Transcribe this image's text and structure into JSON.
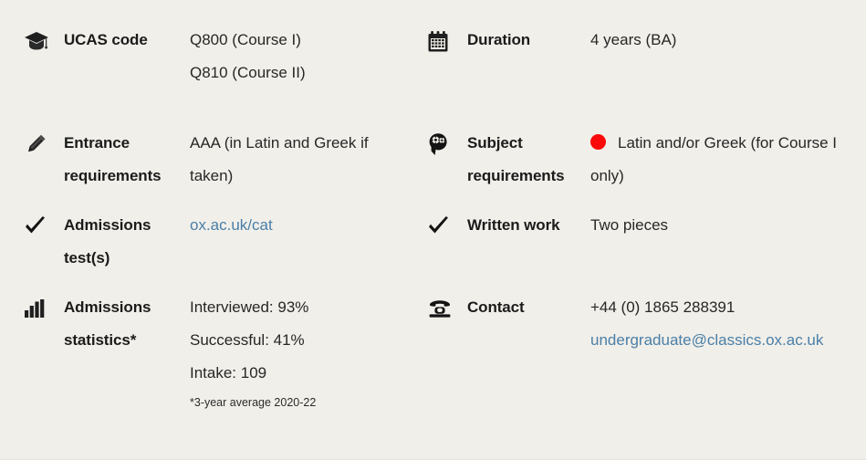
{
  "page": {
    "background_color": "#f1efe9",
    "text_color": "#1b1b1b",
    "link_color": "#4a7fa8",
    "bullet_color": "#fa0a0a"
  },
  "columns": {
    "left": [
      {
        "icon": "graduation-cap-icon",
        "label": "UCAS code",
        "values": [
          "Q800 (Course I)",
          "Q810 (Course II)"
        ]
      },
      {
        "icon": "pencil-icon",
        "label": "Entrance requirements",
        "values": [
          "AAA (in Latin and Greek if taken)"
        ]
      },
      {
        "icon": "checkmark-icon",
        "label": "Admissions test(s)",
        "values": [
          "ox.ac.uk/cat"
        ],
        "link": "ox.ac.uk/cat"
      },
      {
        "icon": "bar-chart-icon",
        "label": "Admissions statistics*",
        "values": [
          "Interviewed: 93%",
          "Successful: 41%",
          "Intake: 109"
        ],
        "footnote": "*3-year average 2020-22"
      }
    ],
    "right": [
      {
        "icon": "calendar-icon",
        "label": "Duration",
        "values": [
          "4 years (BA)"
        ]
      },
      {
        "icon": "head-gears-icon",
        "label": "Subject requirements",
        "values": [
          "Latin and/or Greek (for Course I only)"
        ],
        "bullet": true
      },
      {
        "icon": "checkmark-icon",
        "label": "Written work",
        "values": [
          "Two pieces"
        ]
      },
      {
        "icon": "telephone-icon",
        "label": "Contact",
        "values": [
          "+44 (0) 1865 288391",
          "undergraduate@classics.ox.ac.uk"
        ],
        "link": "undergraduate@classics.ox.ac.uk"
      }
    ]
  }
}
